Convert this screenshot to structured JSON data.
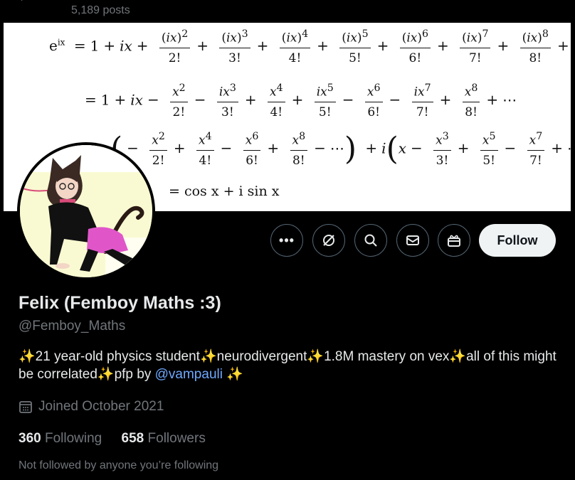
{
  "header": {
    "post_count": "5,189 posts"
  },
  "banner": {
    "formula": {
      "lhs": "e",
      "lhs_exp": "ix",
      "eq_lines": [
        "= 1 + ix +",
        "= 1 + ix −",
        "= cos x + i sin x"
      ],
      "terms_line1": [
        "(ix)2/2!",
        "(ix)3/3!",
        "(ix)4/4!",
        "(ix)5/5!",
        "(ix)6/6!",
        "(ix)7/7!",
        "(ix)8/8!"
      ],
      "terms_line2": [
        "x2/2!",
        "ix3/3!",
        "x4/4!",
        "ix5/5!",
        "x6/6!",
        "ix7/7!",
        "x8/8!"
      ],
      "terms_line3_cos": [
        "x2/2!",
        "x4/4!",
        "x6/6!",
        "x8/8!"
      ],
      "terms_line3_sin": [
        "x3/3!",
        "x5/5!",
        "x7/7!"
      ]
    }
  },
  "actions": {
    "more_icon": "more-icon",
    "grok_icon": "grok-icon",
    "search_icon": "search-icon",
    "message_icon": "message-icon",
    "gift_icon": "gift-icon",
    "follow_label": "Follow"
  },
  "profile": {
    "display_name": "Felix (Femboy Maths :3)",
    "handle": "@Femboy_Maths",
    "bio_part1": "21 year-old physics student",
    "bio_part2": "neurodivergent",
    "bio_part3": "1.8M mastery on vex",
    "bio_part4": "all of this might be correlated",
    "bio_part5": "pfp by ",
    "bio_mention": "@vampauli",
    "sparkle": "✨",
    "joined": "Joined October 2021",
    "following_count": "360",
    "following_label": "Following",
    "followers_count": "658",
    "followers_label": "Followers",
    "not_followed_text": "Not followed by anyone you’re following"
  },
  "colors": {
    "background": "#000000",
    "text_primary": "#e7e9ea",
    "text_secondary": "#71767b",
    "link": "#6ea8fe",
    "follow_bg": "#eff3f4"
  }
}
